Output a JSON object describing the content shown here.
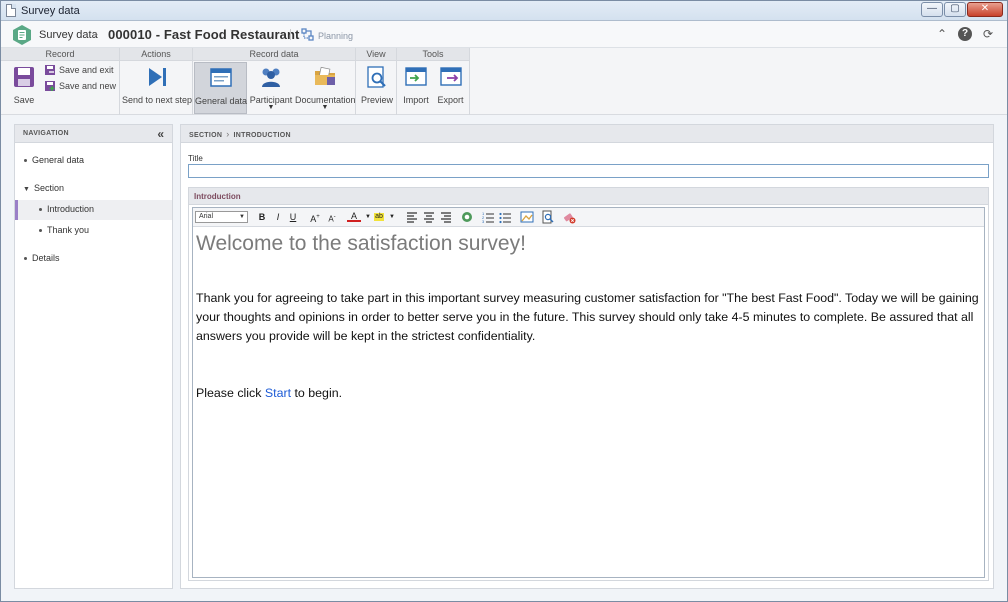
{
  "window": {
    "title": "Survey data"
  },
  "header": {
    "breadcrumb": "Survey data",
    "record_title": "000010 - Fast Food Restaurant",
    "status": "Planning"
  },
  "ribbon": {
    "groups": {
      "record": "Record",
      "actions": "Actions",
      "record_data": "Record data",
      "view": "View",
      "tools": "Tools"
    },
    "save": "Save",
    "save_and_exit": "Save and exit",
    "save_and_new": "Save and new",
    "send_to_next_step": "Send to next step",
    "general_data": "General data",
    "participant": "Participant",
    "documentation": "Documentation",
    "preview": "Preview",
    "import": "Import",
    "export": "Export"
  },
  "navigation": {
    "title": "NAVIGATION",
    "items": [
      {
        "label": "General data"
      },
      {
        "label": "Section"
      },
      {
        "label": "Introduction"
      },
      {
        "label": "Thank you"
      },
      {
        "label": "Details"
      }
    ]
  },
  "main": {
    "breadcrumb": [
      "SECTION",
      "INTRODUCTION"
    ],
    "title_label": "Title",
    "title_value": "",
    "panel_title": "Introduction",
    "editor": {
      "font": "Arial",
      "heading": "Welcome to the satisfaction survey!",
      "paragraph": "Thank you for agreeing to take part in this important survey measuring customer satisfaction for \"The best Fast Food\". Today we will be gaining your thoughts and opinions in order to better serve you in the future. This survey should only take 4-5 minutes to complete. Be assured that all answers you provide will be kept in the strictest confidentiality.",
      "cta_before": "Please click ",
      "cta_link": "Start",
      "cta_after": " to begin."
    }
  },
  "colors": {
    "accent": "#5a4ea1",
    "link": "#1d5bd6",
    "panel_title": "#7d4b5f",
    "selected_nav_border": "#9a7fc7"
  }
}
